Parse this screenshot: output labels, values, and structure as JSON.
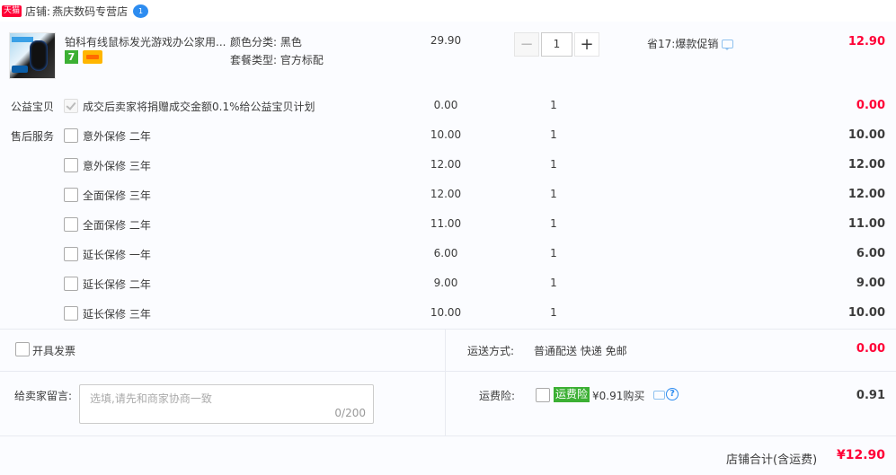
{
  "shop": {
    "platform_badge": "天猫",
    "label": "店铺:",
    "name": "燕庆数码专营店",
    "chat_badge": "1"
  },
  "item": {
    "title": "铂科有线鼠标发光游戏办公家用...",
    "badge_7": "7",
    "attr_color": "颜色分类:  黑色",
    "attr_package": "套餐类型:  官方标配",
    "unit_price": "29.90",
    "quantity": "1",
    "minus_label": "−",
    "plus_label": "+",
    "promo": "省17:爆款促销",
    "total": "12.90"
  },
  "services": {
    "charity_label": "公益宝贝",
    "charity_text": "成交后卖家将捐赠成交金额0.1%给公益宝贝计划",
    "charity_price": "0.00",
    "charity_qty": "1",
    "charity_total": "0.00",
    "after_sale_label": "售后服务",
    "items": [
      {
        "name": "意外保修 二年",
        "price": "10.00",
        "qty": "1",
        "total": "10.00"
      },
      {
        "name": "意外保修 三年",
        "price": "12.00",
        "qty": "1",
        "total": "12.00"
      },
      {
        "name": "全面保修 三年",
        "price": "12.00",
        "qty": "1",
        "total": "12.00"
      },
      {
        "name": "全面保修 二年",
        "price": "11.00",
        "qty": "1",
        "total": "11.00"
      },
      {
        "name": "延长保修 一年",
        "price": "6.00",
        "qty": "1",
        "total": "6.00"
      },
      {
        "name": "延长保修 二年",
        "price": "9.00",
        "qty": "1",
        "total": "9.00"
      },
      {
        "name": "延长保修 三年",
        "price": "10.00",
        "qty": "1",
        "total": "10.00"
      }
    ]
  },
  "invoice": {
    "label": "开具发票"
  },
  "shipping": {
    "label": "运送方式:",
    "value": "普通配送 快递 免邮",
    "total": "0.00"
  },
  "message": {
    "label": "给卖家留言:",
    "placeholder": "选填,请先和商家协商一致",
    "counter": "0/200"
  },
  "insurance": {
    "label": "运费险:",
    "badge": "运费险",
    "price_text": "¥0.91购买",
    "help": "?",
    "total": "0.91"
  },
  "footer": {
    "label": "店铺合计(含运费)",
    "total": "¥12.90"
  },
  "colors": {
    "accent_red": "#ff0036",
    "tmall_red": "#ff0036",
    "green_badge": "#3cb034",
    "link_blue": "#2d8cf0"
  },
  "icons": [
    "tmall-badge",
    "chat-icon",
    "minus-icon",
    "plus-icon",
    "promo-chat-icon",
    "help-icon",
    "checkbox"
  ]
}
